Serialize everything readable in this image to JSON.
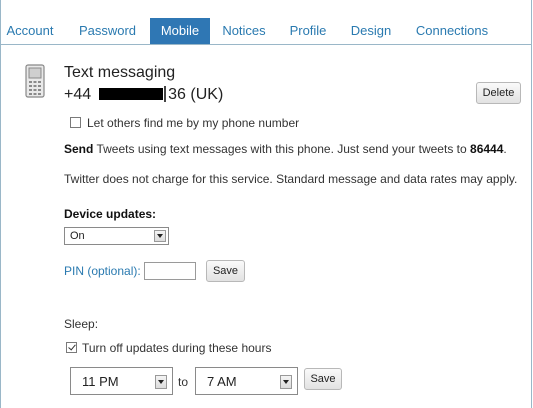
{
  "tabs": [
    {
      "label": "Account",
      "active": false
    },
    {
      "label": "Password",
      "active": false
    },
    {
      "label": "Mobile",
      "active": true
    },
    {
      "label": "Notices",
      "active": false
    },
    {
      "label": "Profile",
      "active": false
    },
    {
      "label": "Design",
      "active": false
    },
    {
      "label": "Connections",
      "active": false
    }
  ],
  "device": {
    "title": "Text messaging",
    "phone_prefix": "+44",
    "phone_suffix": "36 (UK)",
    "delete_label": "Delete",
    "icon": "mobile-phone-icon"
  },
  "find_me": {
    "label": "Let others find me by my phone number",
    "checked": false
  },
  "send_info": {
    "bold_word": "Send",
    "text": "Tweets using text messages with this phone. Just send your tweets to",
    "number": "86444",
    "end": "."
  },
  "charges_note": "Twitter does not charge for this service. Standard message and data rates may apply.",
  "device_updates": {
    "label": "Device updates:",
    "selected": "On"
  },
  "pin": {
    "label": "PIN (optional):",
    "value": "",
    "save_label": "Save"
  },
  "sleep": {
    "label": "Sleep:",
    "checkbox_label": "Turn off updates during these hours",
    "checked": true,
    "from": "11 PM",
    "to_word": "to",
    "to": "7 AM",
    "save_label": "Save"
  },
  "colors": {
    "accent": "#2f77b4",
    "link": "#2a7ab0",
    "frame": "#9ab7c8"
  }
}
